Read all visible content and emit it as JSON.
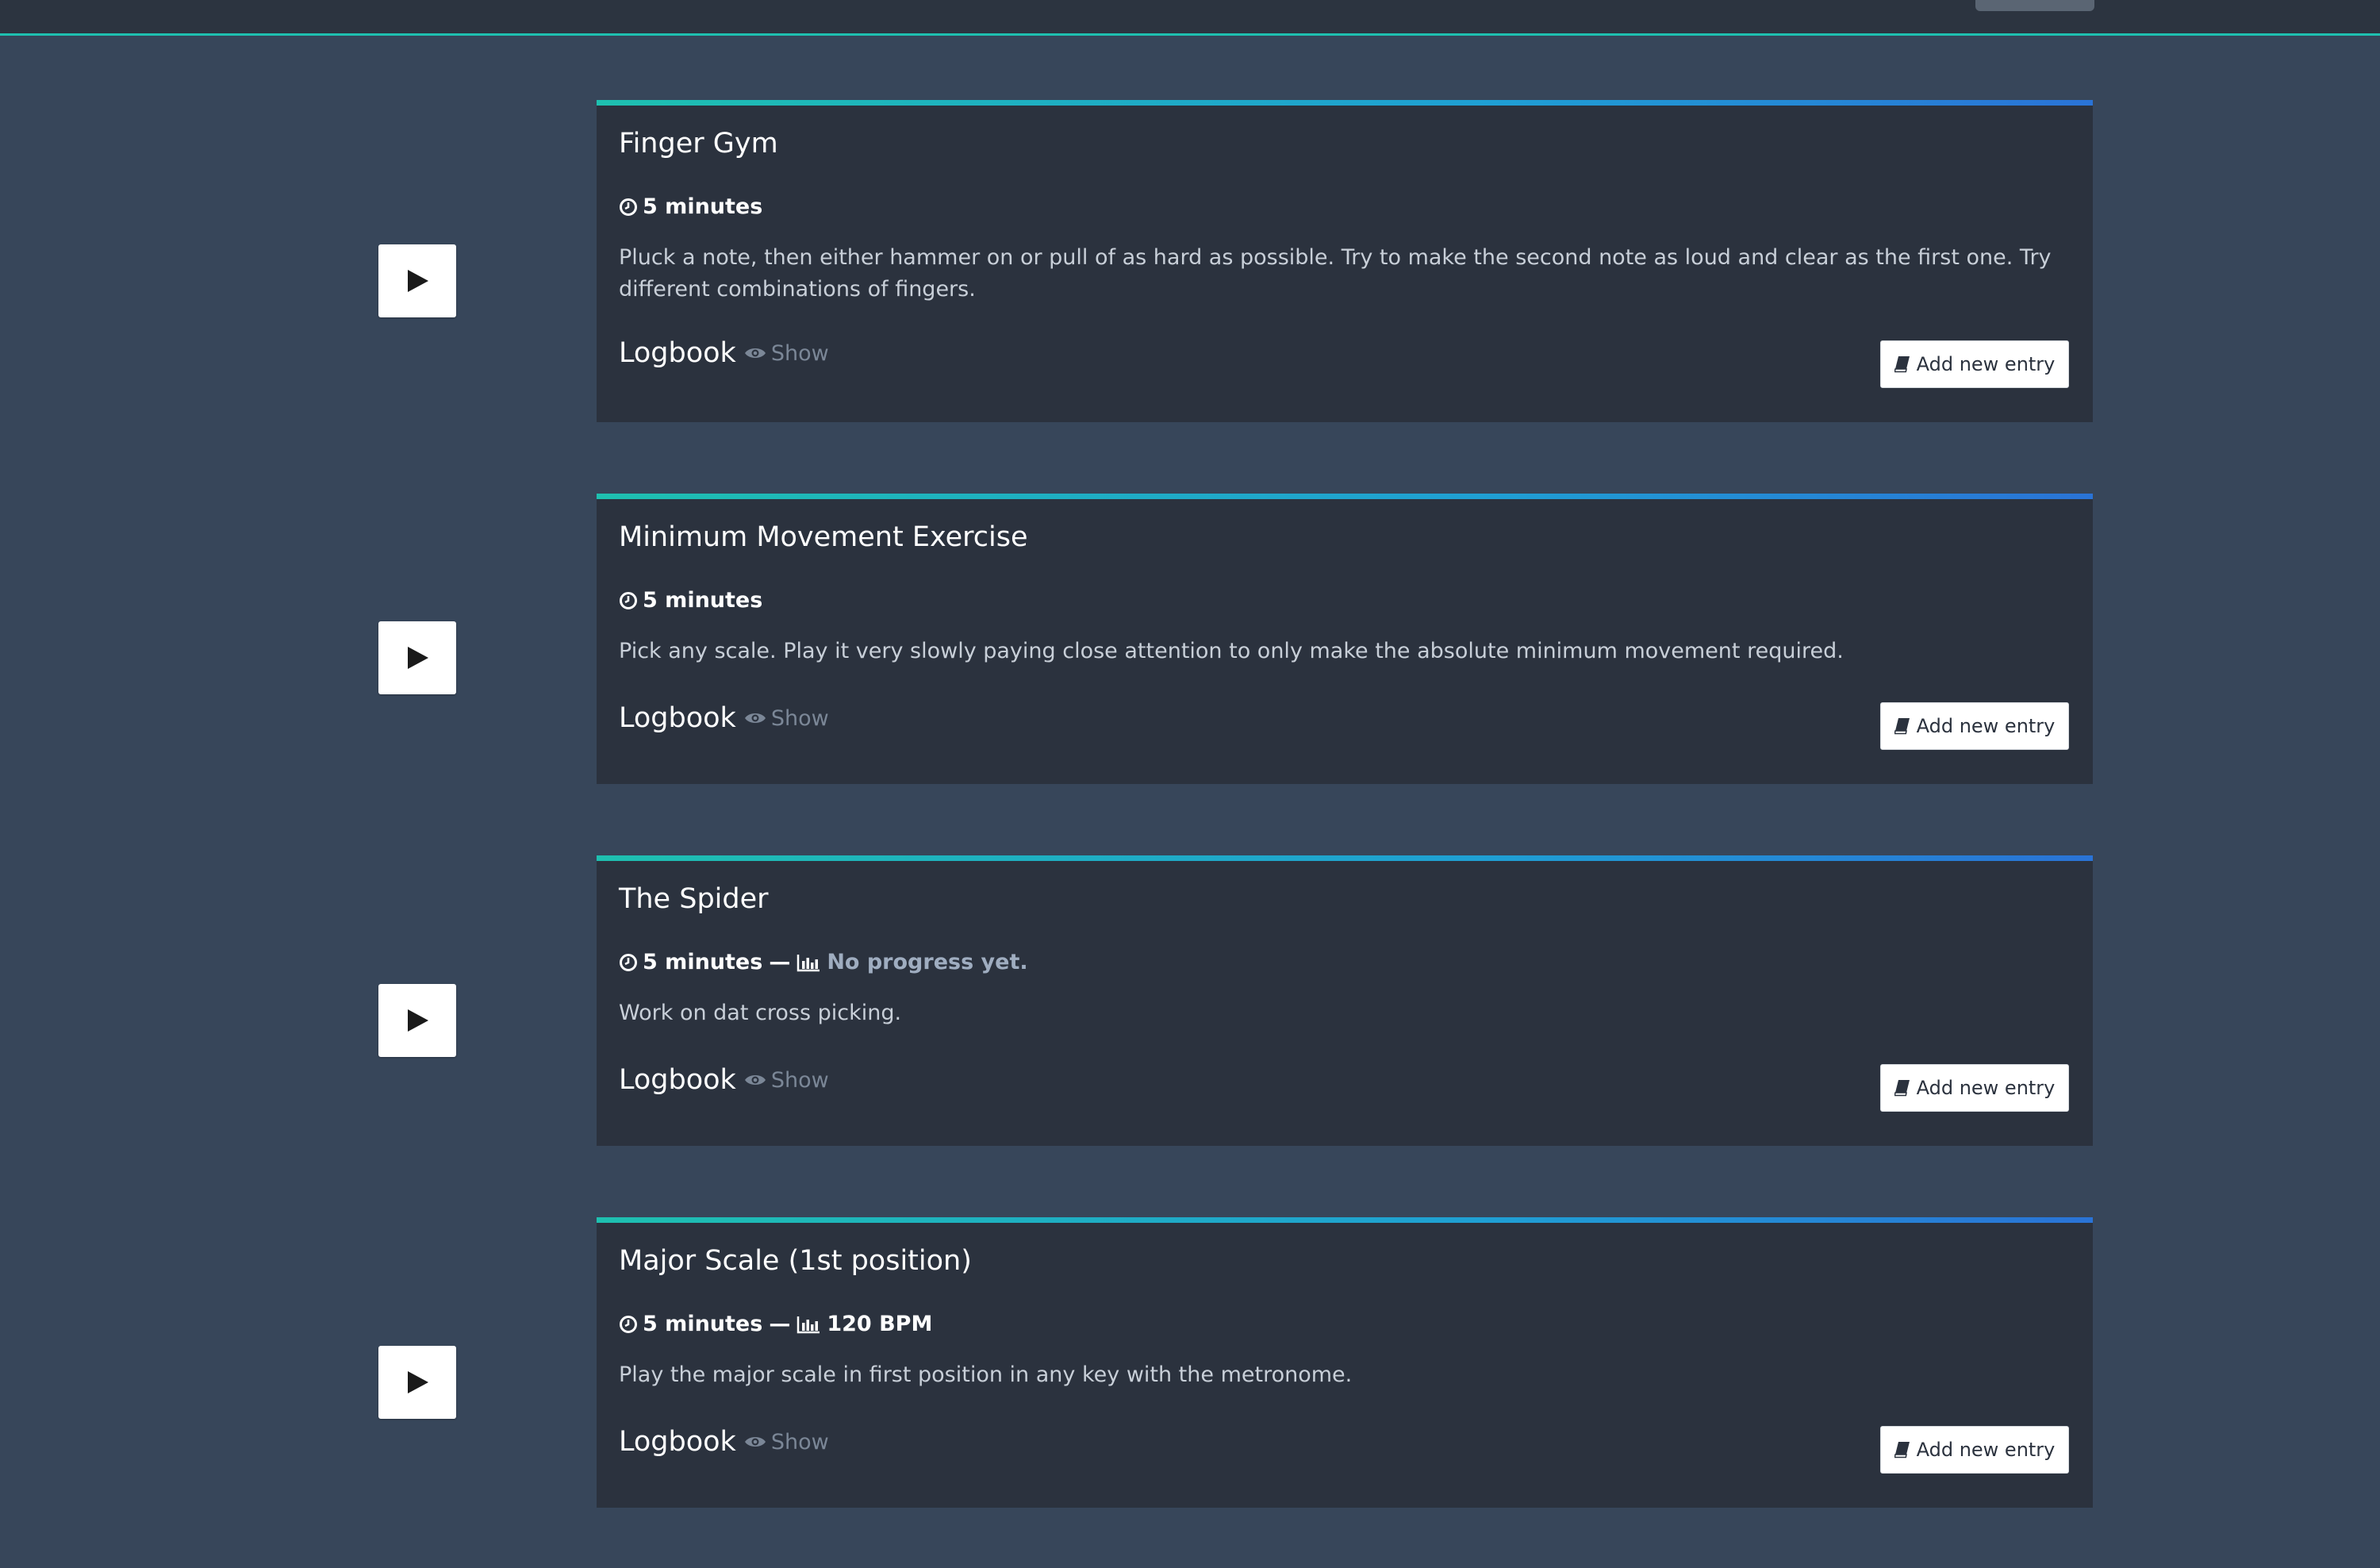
{
  "header": {
    "button_label": ""
  },
  "exercises": [
    {
      "title": "Finger Gym",
      "duration": "5 minutes",
      "progress": "",
      "description": "Pluck a note, then either hammer on or pull of as hard as possible. Try to make the second note as loud and clear as the first one. Try different combinations of fingers.",
      "logbook_label": "Logbook",
      "show_label": "Show",
      "add_entry_label": "Add new entry"
    },
    {
      "title": "Minimum Movement Exercise",
      "duration": "5 minutes",
      "progress": "",
      "description": "Pick any scale. Play it very slowly paying close attention to only make the absolute minimum movement required.",
      "logbook_label": "Logbook",
      "show_label": "Show",
      "add_entry_label": "Add new entry"
    },
    {
      "title": "The Spider",
      "duration": "5 minutes",
      "separator": "—",
      "progress": "No progress yet.",
      "description": "Work on dat cross picking.",
      "logbook_label": "Logbook",
      "show_label": "Show",
      "add_entry_label": "Add new entry"
    },
    {
      "title": "Major Scale (1st position)",
      "duration": "5 minutes",
      "separator": "—",
      "progress": "120 BPM",
      "description": "Play the major scale in first position in any key with the metronome.",
      "logbook_label": "Logbook",
      "show_label": "Show",
      "add_entry_label": "Add new entry"
    }
  ],
  "colors": {
    "page_background": "#37465a",
    "card_background": "#2b323e",
    "accent_start": "#1ec0b0",
    "accent_end": "#2a73d6",
    "muted_text": "#7b8797",
    "progress_muted": "#9fadc0"
  },
  "icons": {
    "play": "play-icon",
    "clock": "clock-icon",
    "chart": "bar-chart-icon",
    "eye": "eye-icon",
    "book": "book-icon"
  }
}
